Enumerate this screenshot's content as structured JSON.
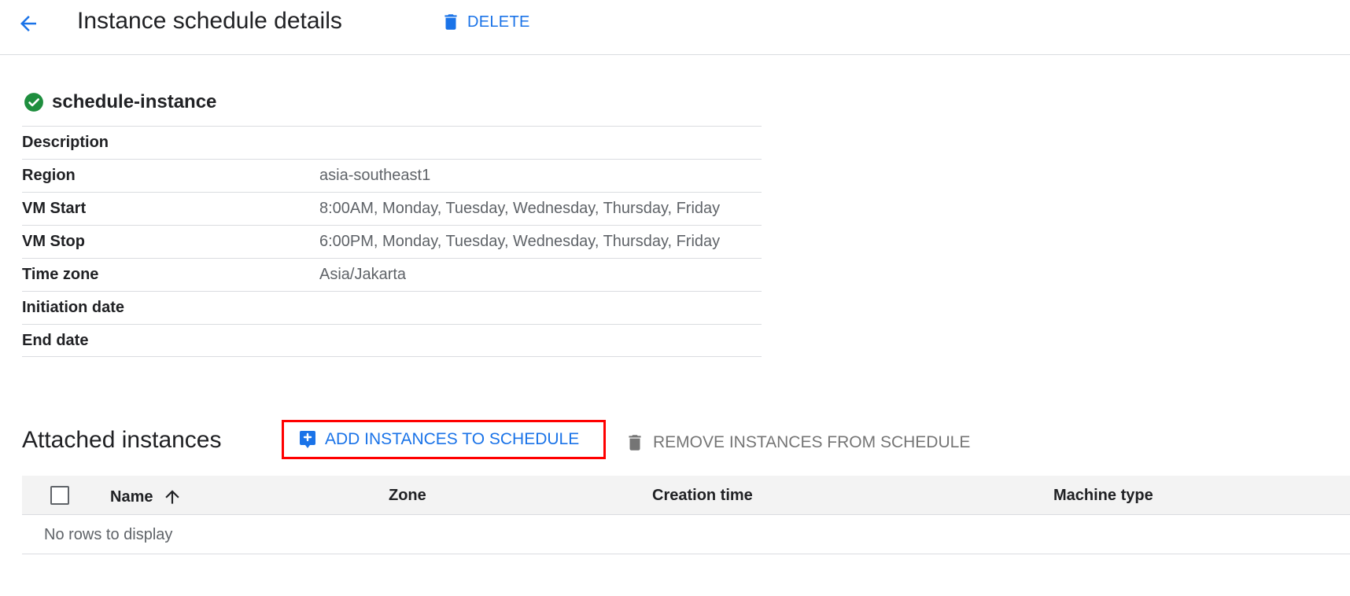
{
  "header": {
    "back_icon": "arrow-left-icon",
    "title": "Instance schedule details",
    "delete_label": "DELETE",
    "delete_icon": "trash-icon",
    "accent_color": "#1a73e8"
  },
  "schedule": {
    "status_icon": "check-circle-icon",
    "status_color": "#1e8e3e",
    "name": "schedule-instance",
    "details": [
      {
        "key": "Description",
        "value": ""
      },
      {
        "key": "Region",
        "value": "asia-southeast1"
      },
      {
        "key": "VM Start",
        "value": "8:00AM, Monday, Tuesday, Wednesday, Thursday, Friday"
      },
      {
        "key": "VM Stop",
        "value": "6:00PM, Monday, Tuesday, Wednesday, Thursday, Friday"
      },
      {
        "key": "Time zone",
        "value": "Asia/Jakarta"
      },
      {
        "key": "Initiation date",
        "value": ""
      },
      {
        "key": "End date",
        "value": ""
      }
    ]
  },
  "attached": {
    "title": "Attached instances",
    "add_label": "ADD INSTANCES TO SCHEDULE",
    "add_icon": "add-box-icon",
    "remove_label": "REMOVE INSTANCES FROM SCHEDULE",
    "remove_icon": "trash-icon",
    "highlight_color": "#ff0000",
    "table": {
      "columns": [
        "Name",
        "Zone",
        "Creation time",
        "Machine type"
      ],
      "sort_icon": "arrow-up-icon",
      "empty_text": "No rows to display"
    }
  }
}
